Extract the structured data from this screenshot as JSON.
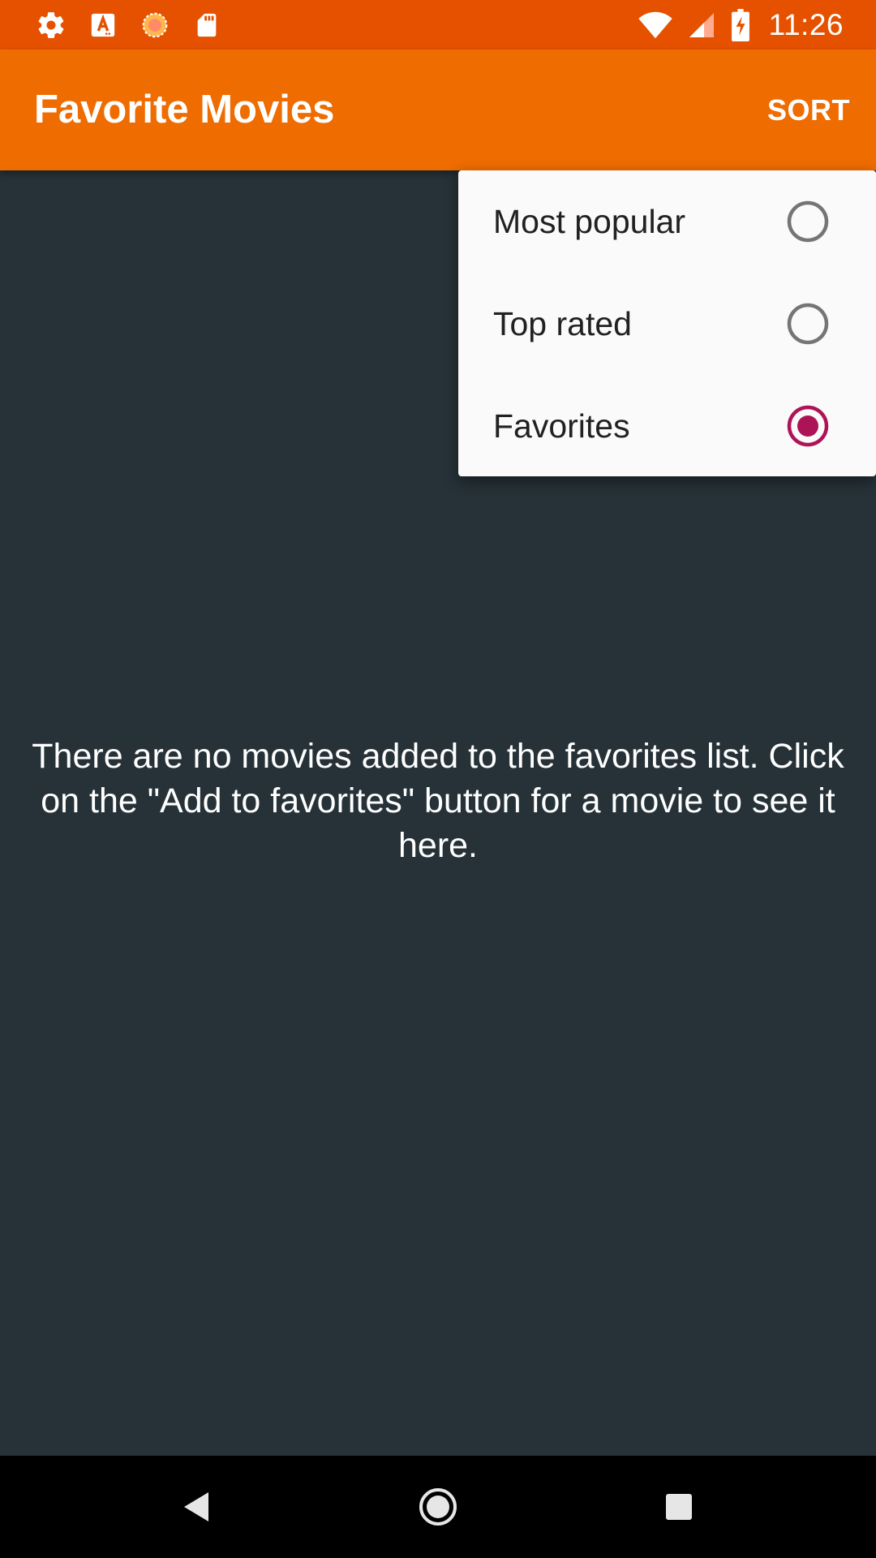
{
  "status_bar": {
    "time": "11:26",
    "left_icons": [
      "gear-icon",
      "a-notification-icon",
      "sync-icon",
      "sd-card-icon"
    ],
    "right_icons": [
      "wifi-icon",
      "signal-icon",
      "battery-charging-icon"
    ]
  },
  "toolbar": {
    "title": "Favorite Movies",
    "sort_label": "SORT"
  },
  "sort_menu": {
    "items": [
      {
        "label": "Most popular",
        "selected": false
      },
      {
        "label": "Top rated",
        "selected": false
      },
      {
        "label": "Favorites",
        "selected": true
      }
    ],
    "accent_color": "#AD1457"
  },
  "main": {
    "empty_message": "There are no movies added to the favorites list. Click on the \"Add to favorites\" button for a movie to see it here."
  },
  "colors": {
    "status_bar": "#E65100",
    "toolbar": "#EF6C00",
    "background": "#263238",
    "menu_background": "#FAFAFA"
  },
  "nav_bar": {
    "buttons": [
      "back-icon",
      "home-icon",
      "recents-icon"
    ]
  }
}
